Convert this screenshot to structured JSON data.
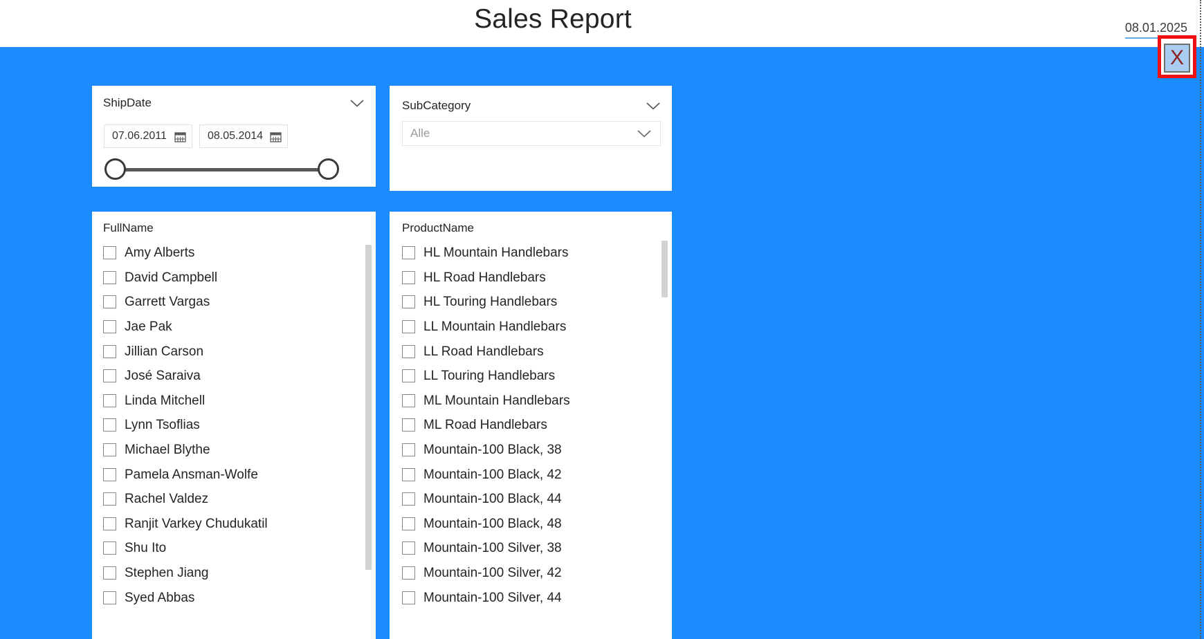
{
  "header": {
    "title": "Sales Report",
    "date": "08.01.2025"
  },
  "close_button": {
    "label": "X"
  },
  "colors": {
    "canvas_background": "#1a8cff",
    "highlight_border": "#ee1111",
    "close_fill": "#a8cdf0",
    "close_glyph": "#8c2222",
    "date_underline": "#5ca9e8"
  },
  "ship_date_slicer": {
    "title": "ShipDate",
    "from_value": "07.06.2011",
    "to_value": "08.05.2014",
    "expand_icon": "chevron-down-icon",
    "calendar_icon": "calendar-icon"
  },
  "subcategory_slicer": {
    "title": "SubCategory",
    "selected_value": "Alle",
    "expand_icon": "chevron-down-icon",
    "dropdown_icon": "chevron-down-icon"
  },
  "fullname_slicer": {
    "title": "FullName",
    "items": [
      "Amy Alberts",
      "David Campbell",
      "Garrett Vargas",
      "Jae Pak",
      "Jillian Carson",
      "José Saraiva",
      "Linda Mitchell",
      "Lynn Tsoflias",
      "Michael Blythe",
      "Pamela Ansman-Wolfe",
      "Rachel Valdez",
      "Ranjit Varkey Chudukatil",
      "Shu Ito",
      "Stephen Jiang",
      "Syed Abbas"
    ]
  },
  "productname_slicer": {
    "title": "ProductName",
    "items": [
      "HL Mountain Handlebars",
      "HL Road Handlebars",
      "HL Touring Handlebars",
      "LL Mountain Handlebars",
      "LL Road Handlebars",
      "LL Touring Handlebars",
      "ML Mountain Handlebars",
      "ML Road Handlebars",
      "Mountain-100 Black, 38",
      "Mountain-100 Black, 42",
      "Mountain-100 Black, 44",
      "Mountain-100 Black, 48",
      "Mountain-100 Silver, 38",
      "Mountain-100 Silver, 42",
      "Mountain-100 Silver, 44"
    ]
  }
}
